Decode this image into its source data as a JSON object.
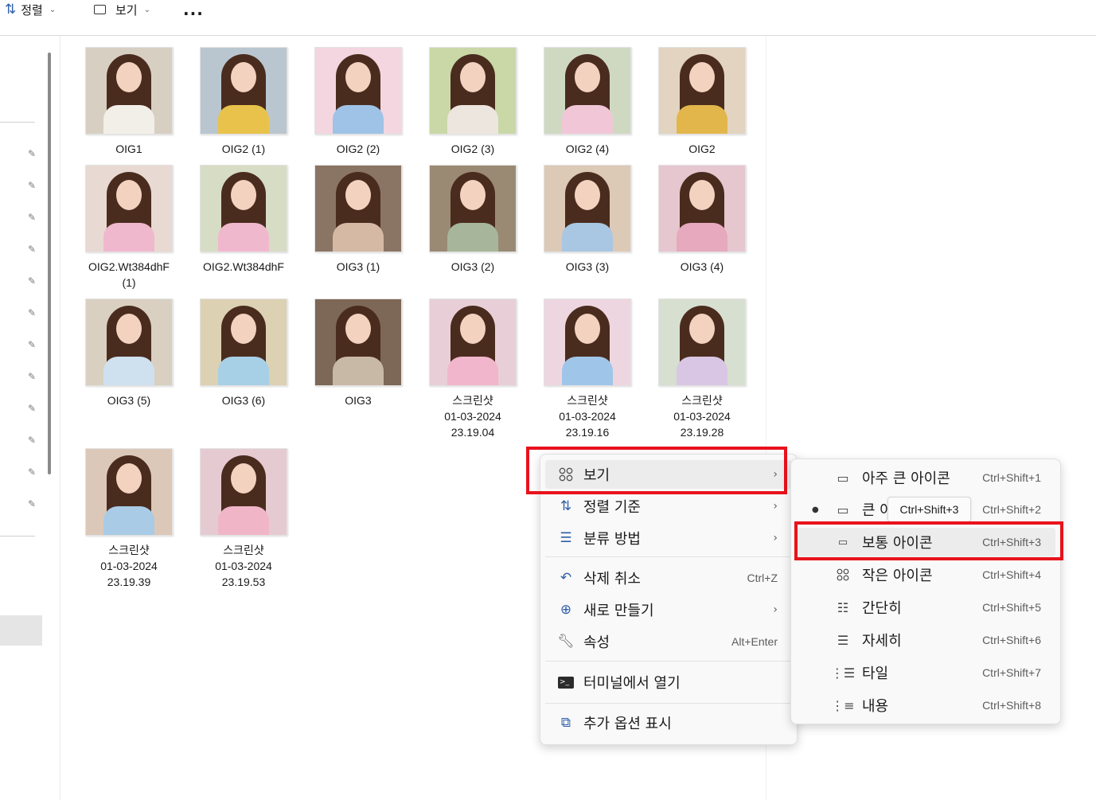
{
  "toolbar": {
    "sort_label": "정렬",
    "view_label": "보기",
    "more_label": "..."
  },
  "files": [
    {
      "name": "OIG1",
      "bg": "#d8cfc3",
      "outfit": "#f2efe9"
    },
    {
      "name": "OIG2 (1)",
      "bg": "#b9c6cf",
      "outfit": "#e8c24a"
    },
    {
      "name": "OIG2 (2)",
      "bg": "#f3d6df",
      "outfit": "#9fc3e6"
    },
    {
      "name": "OIG2 (3)",
      "bg": "#c9d8a6",
      "outfit": "#ece6df"
    },
    {
      "name": "OIG2 (4)",
      "bg": "#cfd9c2",
      "outfit": "#f1c7d8"
    },
    {
      "name": "OIG2",
      "bg": "#e2d4c0",
      "outfit": "#e3b64b"
    },
    {
      "name": "OIG2.Wt384dhF\n(1)",
      "bg": "#e8d9d2",
      "outfit": "#f0b8cd"
    },
    {
      "name": "OIG2.Wt384dhF",
      "bg": "#d7dcc4",
      "outfit": "#f0b8cd"
    },
    {
      "name": "OIG3 (1)",
      "bg": "#8a7463",
      "outfit": "#d5b9a5"
    },
    {
      "name": "OIG3 (2)",
      "bg": "#9a8a73",
      "outfit": "#a7b69a"
    },
    {
      "name": "OIG3 (3)",
      "bg": "#dcc9b6",
      "outfit": "#a9c7e2"
    },
    {
      "name": "OIG3 (4)",
      "bg": "#e6c7cf",
      "outfit": "#e7a9bd"
    },
    {
      "name": "OIG3 (5)",
      "bg": "#d9d0c1",
      "outfit": "#cfe0ee"
    },
    {
      "name": "OIG3 (6)",
      "bg": "#dcd1b3",
      "outfit": "#a7d0e6"
    },
    {
      "name": "OIG3",
      "bg": "#7d6756",
      "outfit": "#c8b9a7"
    },
    {
      "name": "스크린샷\n01-03-2024\n23.19.04",
      "bg": "#e8cfd7",
      "outfit": "#f1b6cb"
    },
    {
      "name": "스크린샷\n01-03-2024\n23.19.16",
      "bg": "#eed6e0",
      "outfit": "#9fc6e8"
    },
    {
      "name": "스크린샷\n01-03-2024\n23.19.28",
      "bg": "#d7dfd0",
      "outfit": "#d9c6e4"
    },
    {
      "name": "스크린샷\n01-03-2024\n23.19.39",
      "bg": "#dbc8b8",
      "outfit": "#a9cbe5"
    },
    {
      "name": "스크린샷\n01-03-2024\n23.19.53",
      "bg": "#e6cad2",
      "outfit": "#f0b6c8"
    }
  ],
  "context_menu": {
    "view": "보기",
    "sort_by": "정렬 기준",
    "group_by": "분류 방법",
    "undo": "삭제 취소",
    "undo_shortcut": "Ctrl+Z",
    "new": "새로 만들기",
    "properties": "속성",
    "properties_shortcut": "Alt+Enter",
    "open_terminal": "터미널에서 열기",
    "show_more": "추가 옵션 표시"
  },
  "view_submenu": {
    "items": [
      {
        "label": "아주 큰 아이콘",
        "shortcut": "Ctrl+Shift+1"
      },
      {
        "label": "큰 아이콘",
        "label_visible": "큰 아",
        "shortcut": "Ctrl+Shift+2",
        "selected": true
      },
      {
        "label": "보통 아이콘",
        "shortcut": "Ctrl+Shift+3"
      },
      {
        "label": "작은 아이콘",
        "shortcut": "Ctrl+Shift+4"
      },
      {
        "label": "간단히",
        "shortcut": "Ctrl+Shift+5"
      },
      {
        "label": "자세히",
        "shortcut": "Ctrl+Shift+6"
      },
      {
        "label": "타일",
        "shortcut": "Ctrl+Shift+7"
      },
      {
        "label": "내용",
        "shortcut": "Ctrl+Shift+8"
      }
    ],
    "tooltip": "Ctrl+Shift+3"
  },
  "colors": {
    "accent": "#2f5fa8",
    "highlight": "#e8121c"
  }
}
